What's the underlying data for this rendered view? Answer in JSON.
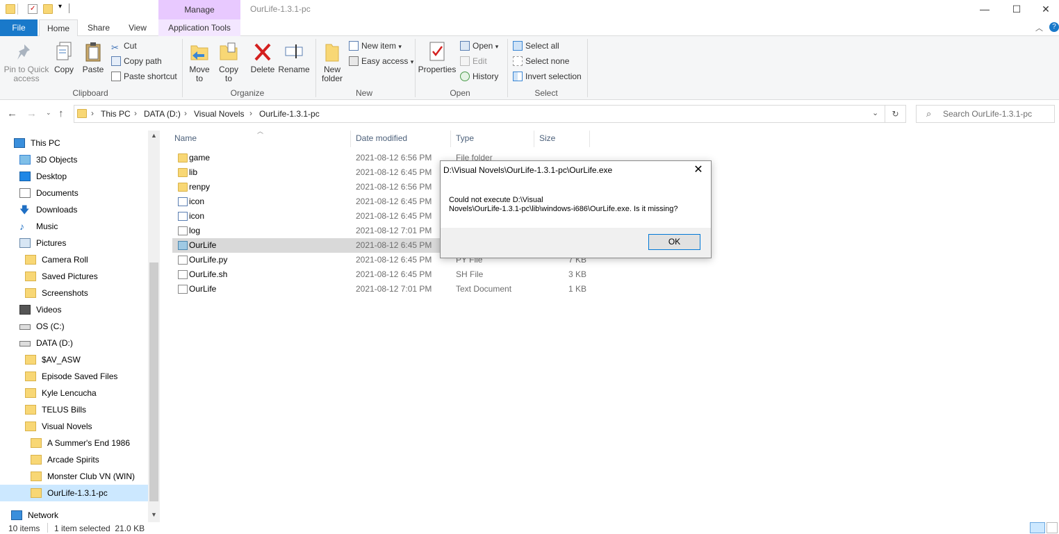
{
  "window": {
    "title": "OurLife-1.3.1-pc",
    "contextual_tab_group": "Manage",
    "minimize": "—",
    "maximize": "☐",
    "close": "✕"
  },
  "ribbon": {
    "tabs": [
      "File",
      "Home",
      "Share",
      "View",
      "Application Tools"
    ],
    "clipboard": {
      "label": "Clipboard",
      "pin": "Pin to Quick access",
      "copy": "Copy",
      "paste": "Paste",
      "cut": "Cut",
      "copy_path": "Copy path",
      "paste_shortcut": "Paste shortcut"
    },
    "organize": {
      "label": "Organize",
      "move_to": "Move to",
      "copy_to": "Copy to",
      "delete": "Delete",
      "rename": "Rename"
    },
    "new": {
      "label": "New",
      "new_folder": "New folder",
      "new_item": "New item",
      "easy_access": "Easy access"
    },
    "open": {
      "label": "Open",
      "properties": "Properties",
      "open": "Open",
      "edit": "Edit",
      "history": "History"
    },
    "select": {
      "label": "Select",
      "select_all": "Select all",
      "select_none": "Select none",
      "invert_selection": "Invert selection"
    }
  },
  "address": {
    "breadcrumbs": [
      "This PC",
      "DATA (D:)",
      "Visual Novels",
      "OurLife-1.3.1-pc"
    ],
    "search_placeholder": "Search OurLife-1.3.1-pc"
  },
  "nav_pane": {
    "items": [
      {
        "label": "This PC",
        "icon": "pc-icon"
      },
      {
        "label": "3D Objects",
        "icon": "3d-objects-icon"
      },
      {
        "label": "Desktop",
        "icon": "desktop-icon"
      },
      {
        "label": "Documents",
        "icon": "documents-icon"
      },
      {
        "label": "Downloads",
        "icon": "downloads-icon"
      },
      {
        "label": "Music",
        "icon": "music-icon"
      },
      {
        "label": "Pictures",
        "icon": "pictures-icon"
      },
      {
        "label": "Camera Roll",
        "icon": "folder-icon"
      },
      {
        "label": "Saved Pictures",
        "icon": "folder-icon"
      },
      {
        "label": "Screenshots",
        "icon": "folder-icon"
      },
      {
        "label": "Videos",
        "icon": "videos-icon"
      },
      {
        "label": "OS (C:)",
        "icon": "drive-icon"
      },
      {
        "label": "DATA (D:)",
        "icon": "drive-icon"
      },
      {
        "label": "$AV_ASW",
        "icon": "folder-icon"
      },
      {
        "label": "Episode Saved Files",
        "icon": "folder-icon"
      },
      {
        "label": "Kyle Lencucha",
        "icon": "folder-icon"
      },
      {
        "label": "TELUS Bills",
        "icon": "folder-icon"
      },
      {
        "label": "Visual Novels",
        "icon": "folder-icon"
      },
      {
        "label": "A Summer's End 1986",
        "icon": "folder-icon"
      },
      {
        "label": "Arcade Spirits",
        "icon": "folder-icon"
      },
      {
        "label": "Monster Club VN (WIN)",
        "icon": "folder-icon"
      },
      {
        "label": "OurLife-1.3.1-pc",
        "icon": "folder-icon"
      },
      {
        "label": "Network",
        "icon": "network-icon"
      }
    ]
  },
  "file_list": {
    "columns": [
      "Name",
      "Date modified",
      "Type",
      "Size"
    ],
    "rows": [
      {
        "name": "game",
        "date": "2021-08-12 6:56 PM",
        "type": "File folder",
        "size": "",
        "icon": "folder-icon"
      },
      {
        "name": "lib",
        "date": "2021-08-12 6:45 PM",
        "type": "",
        "size": "",
        "icon": "folder-icon"
      },
      {
        "name": "renpy",
        "date": "2021-08-12 6:56 PM",
        "type": "",
        "size": "",
        "icon": "folder-icon"
      },
      {
        "name": "icon",
        "date": "2021-08-12 6:45 PM",
        "type": "",
        "size": "",
        "icon": "image-file-icon"
      },
      {
        "name": "icon",
        "date": "2021-08-12 6:45 PM",
        "type": "",
        "size": "",
        "icon": "image-file-icon"
      },
      {
        "name": "log",
        "date": "2021-08-12 7:01 PM",
        "type": "",
        "size": "",
        "icon": "text-file-icon"
      },
      {
        "name": "OurLife",
        "date": "2021-08-12 6:45 PM",
        "type": "",
        "size": "",
        "icon": "application-icon"
      },
      {
        "name": "OurLife.py",
        "date": "2021-08-12 6:45 PM",
        "type": "PY File",
        "size": "7 KB",
        "icon": "file-icon"
      },
      {
        "name": "OurLife.sh",
        "date": "2021-08-12 6:45 PM",
        "type": "SH File",
        "size": "3 KB",
        "icon": "file-icon"
      },
      {
        "name": "OurLife",
        "date": "2021-08-12 7:01 PM",
        "type": "Text Document",
        "size": "1 KB",
        "icon": "text-file-icon"
      }
    ]
  },
  "status": {
    "items_count": "10 items",
    "selection": "1 item selected  21.0 KB"
  },
  "dialog": {
    "title": "D:\\Visual Novels\\OurLife-1.3.1-pc\\OurLife.exe",
    "message_line1": "Could not execute D:\\Visual",
    "message_line2": "Novels\\OurLife-1.3.1-pc\\lib\\windows-i686\\OurLife.exe. Is it missing?",
    "ok": "OK",
    "close": "✕"
  }
}
